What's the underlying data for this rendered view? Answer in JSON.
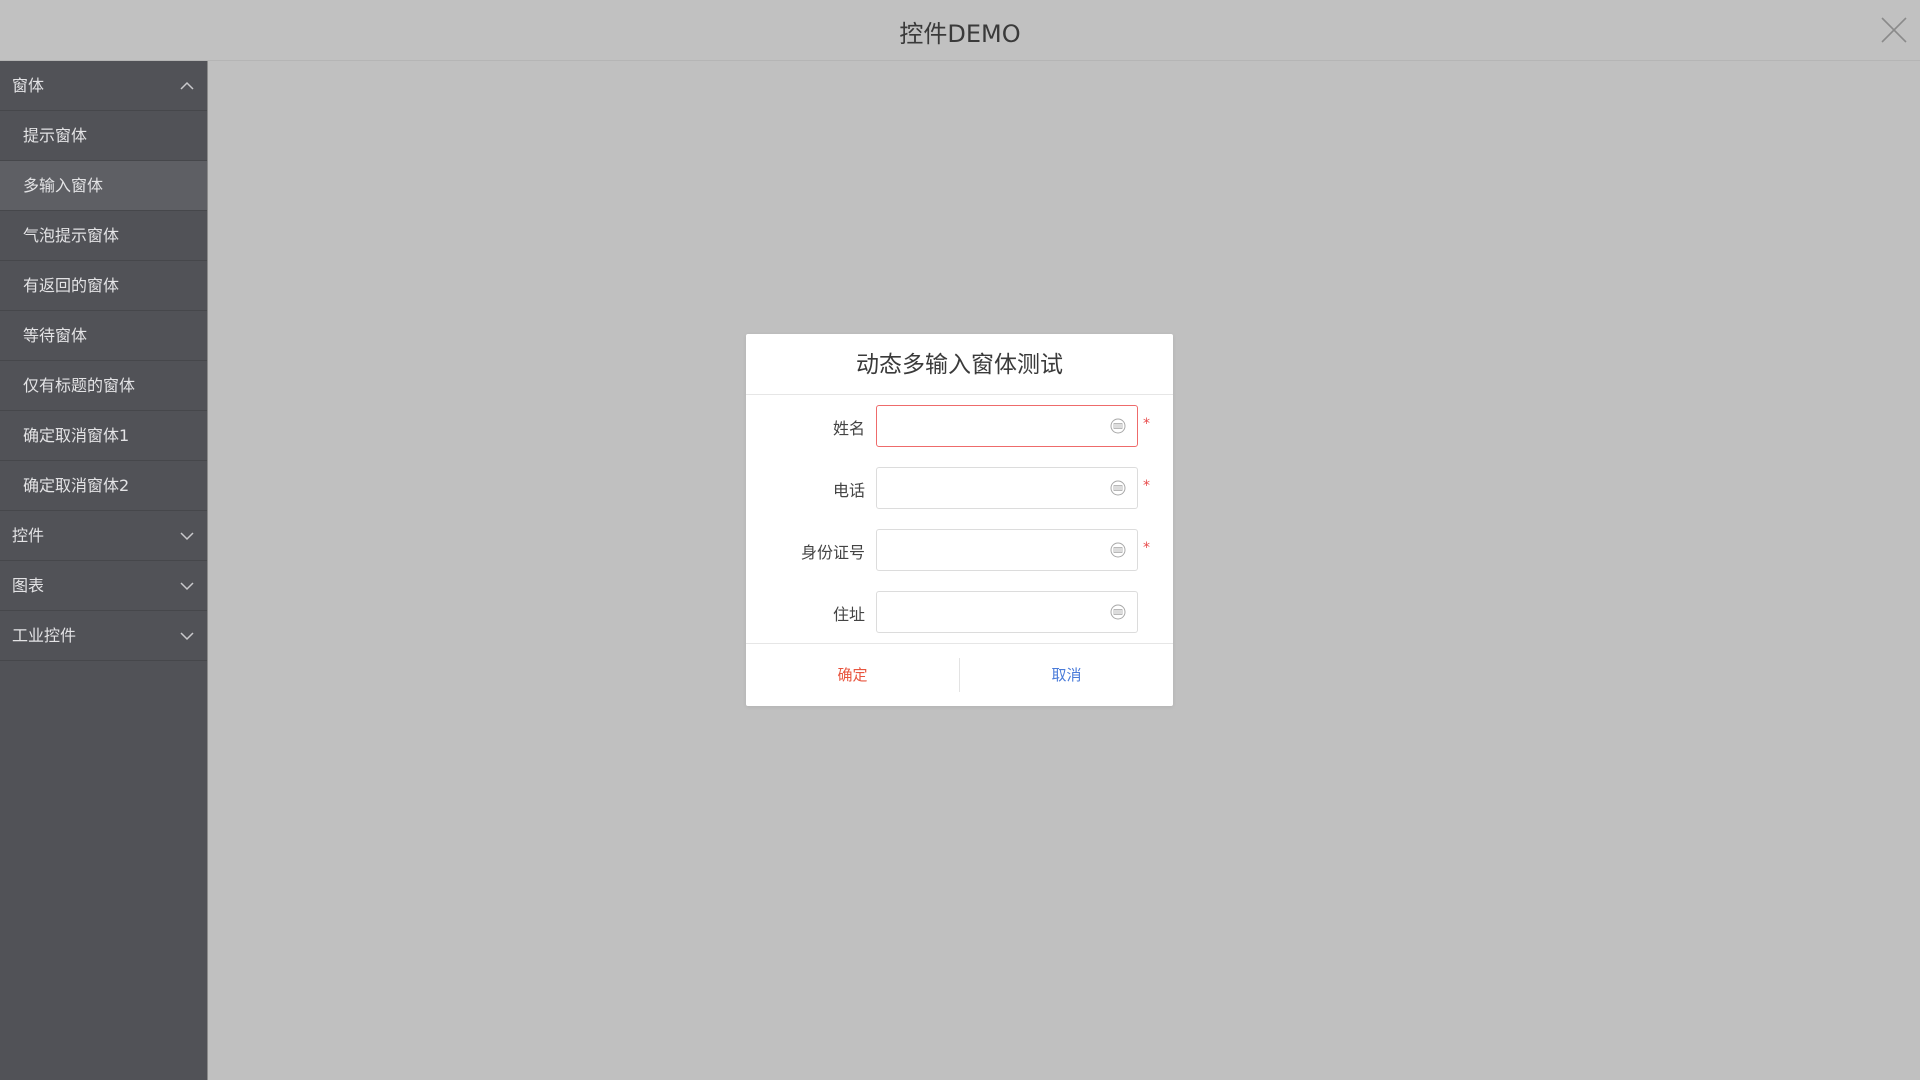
{
  "window": {
    "title": "控件DEMO"
  },
  "sidebar": {
    "groups": [
      {
        "label": "窗体",
        "expanded": true,
        "items": [
          {
            "label": "提示窗体"
          },
          {
            "label": "多输入窗体",
            "active": true
          },
          {
            "label": "气泡提示窗体"
          },
          {
            "label": "有返回的窗体"
          },
          {
            "label": "等待窗体"
          },
          {
            "label": "仅有标题的窗体"
          },
          {
            "label": "确定取消窗体1"
          },
          {
            "label": "确定取消窗体2"
          }
        ]
      },
      {
        "label": "控件",
        "expanded": false
      },
      {
        "label": "图表",
        "expanded": false
      },
      {
        "label": "工业控件",
        "expanded": false
      }
    ]
  },
  "dialog": {
    "title": "动态多输入窗体测试",
    "fields": [
      {
        "label": "姓名",
        "value": "",
        "required": true,
        "required_mark": "*",
        "error": true
      },
      {
        "label": "电话",
        "value": "",
        "required": true,
        "required_mark": "*",
        "error": false
      },
      {
        "label": "身份证号",
        "value": "",
        "required": true,
        "required_mark": "*",
        "error": false
      },
      {
        "label": "住址",
        "value": "",
        "required": false,
        "required_mark": "",
        "error": false
      }
    ],
    "ok_label": "确定",
    "cancel_label": "取消"
  },
  "colors": {
    "background": "#c0c0c0",
    "sidebar": "#515257",
    "sidebar_active": "#5e5f64",
    "ok": "#e8553f",
    "cancel": "#4a7bd9",
    "required": "#e84b4b",
    "error_border": "#ee6b6b"
  }
}
